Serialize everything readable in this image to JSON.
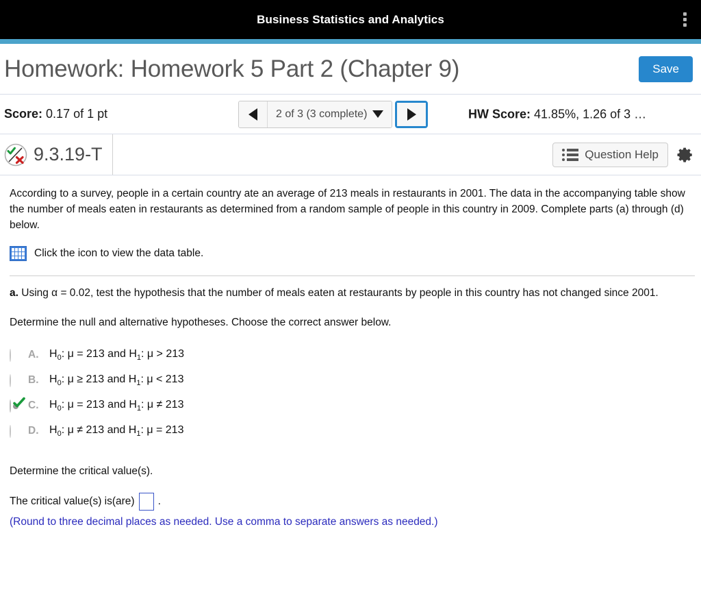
{
  "appbar": {
    "title": "Business Statistics and Analytics",
    "menu_icon": "kebab-menu-icon"
  },
  "header": {
    "homework_title": "Homework: Homework 5 Part 2 (Chapter 9)",
    "save_label": "Save"
  },
  "score_bar": {
    "score_label": "Score:",
    "score_value": "0.17 of 1 pt",
    "prev_icon": "triangle-left-icon",
    "next_icon": "triangle-right-icon",
    "navigator_label": "2 of 3 (3 complete)",
    "caret_icon": "caret-down-icon",
    "hw_score_label": "HW Score:",
    "hw_score_value": "41.85%, 1.26 of 3 …"
  },
  "question_bar": {
    "status_icon": "check-and-x-circle-icon",
    "question_id": "9.3.19-T",
    "help_label": "Question Help",
    "help_icon": "list-icon",
    "settings_icon": "gear-icon"
  },
  "question": {
    "stem": "According to a survey, people in a certain country ate an average of 213 meals in restaurants in 2001. The data in the accompanying table show the number of meals eaten in restaurants as determined from a random sample of people in this country in 2009. Complete parts (a) through (d) below.",
    "data_table_icon": "table-grid-icon",
    "data_table_link": "Click the icon to view the data table.",
    "part_a_prefix": "a.",
    "part_a_text": "Using α = 0.02, test the hypothesis that the number of meals eaten at restaurants by people in this country has not changed since 2001.",
    "prompt": "Determine the null and alternative hypotheses. Choose the correct answer below.",
    "options": [
      {
        "letter": "A.",
        "null_hyp": "H₀: μ = 213",
        "alt_hyp": "H₁: μ > 213",
        "text": "H0: μ = 213 and H1: μ > 213",
        "selected": false
      },
      {
        "letter": "B.",
        "null_hyp": "H₀: μ ≥ 213",
        "alt_hyp": "H₁: μ < 213",
        "text": "H0: μ ≥ 213 and H1: μ < 213",
        "selected": false
      },
      {
        "letter": "C.",
        "null_hyp": "H₀: μ = 213",
        "alt_hyp": "H₁: μ ≠ 213",
        "text": "H0: μ = 213 and H1: μ ≠ 213",
        "selected": true
      },
      {
        "letter": "D.",
        "null_hyp": "H₀: μ ≠ 213",
        "alt_hyp": "H₁: μ = 213",
        "text": "H0: μ ≠ 213 and H1: μ = 213",
        "selected": false
      }
    ],
    "critical_prompt": "Determine the critical value(s).",
    "critical_sentence_before": "The critical value(s) is(are)",
    "critical_sentence_after": ".",
    "critical_value": "",
    "rounding_note": "(Round to three decimal places as needed. Use a comma to separate answers as needed.)"
  },
  "colors": {
    "accent_blue": "#4ba3ca",
    "button_blue": "#2787cd",
    "note_blue": "#2b2bbd",
    "appbar_black": "#000000",
    "check_green": "#1a9a3c",
    "x_red": "#cc2222",
    "grid_icon_blue": "#3b7dd8"
  }
}
